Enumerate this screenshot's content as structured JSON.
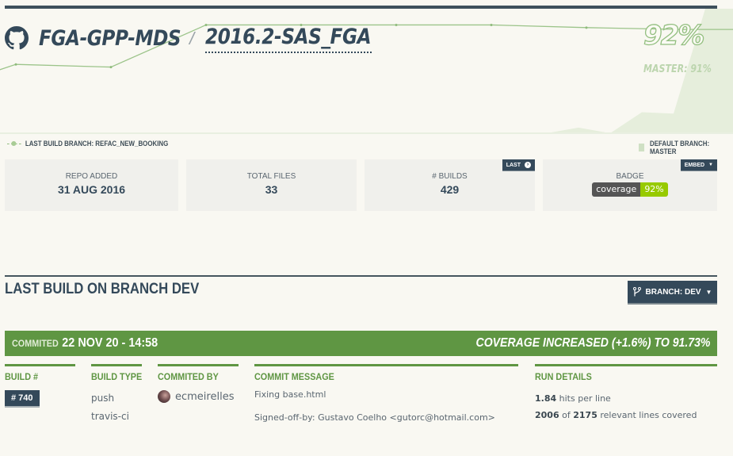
{
  "header": {
    "owner": "FGA-GPP-MDS",
    "separator": "/",
    "repo": "2016.2-SAS_FGA",
    "coverage_pct": "92%",
    "master_pct": "MASTER: 91%"
  },
  "chart_data": {
    "type": "line",
    "title": "",
    "series": [
      {
        "name": "Last build branch: refac_new_booking",
        "style": "line",
        "values": [
          84,
          87.5,
          87.2,
          91.9,
          91.9,
          91.9,
          91.9,
          91.6,
          91.4
        ]
      },
      {
        "name": "Default branch: master",
        "style": "area",
        "values": [
          0,
          0,
          0,
          0,
          0,
          0,
          0,
          4,
          0,
          15,
          14,
          91,
          91
        ]
      }
    ],
    "ylim": [
      80,
      93
    ],
    "legend": {
      "left": "LAST BUILD BRANCH: REFAC_NEW_BOOKING",
      "right": "DEFAULT BRANCH: MASTER"
    },
    "grid": false
  },
  "stats": [
    {
      "label": "REPO ADDED",
      "value": "31 AUG 2016"
    },
    {
      "label": "TOTAL FILES",
      "value": "33"
    },
    {
      "label": "# BUILDS",
      "value": "429",
      "tab": "LAST"
    },
    {
      "label": "BADGE",
      "tab": "EMBED",
      "badge_left": "coverage",
      "badge_right": "92%"
    }
  ],
  "colors": {
    "brand_dark": "#34495a",
    "success_green": "#5f9643",
    "badge_green": "#97ca00",
    "chart_line": "#8fbb7c",
    "chart_area": "#e6eedc"
  },
  "last_build": {
    "title": "LAST BUILD ON BRANCH DEV",
    "branch_button": "BRANCH: DEV",
    "committed_label": "COMMITED",
    "committed_value": "22 NOV 20 - 14:58",
    "coverage_change": "COVERAGE INCREASED (+1.6%) TO 91.73%",
    "columns": {
      "build_num_head": "BUILD #",
      "build_num": "# 740",
      "build_type_head": "BUILD TYPE",
      "build_type": "push",
      "build_service": "travis-ci",
      "committed_by_head": "COMMITED BY",
      "committer": "ecmeirelles",
      "message_head": "COMMIT MESSAGE",
      "message_line1": "Fixing base.html",
      "message_line2": "Signed-off-by: Gustavo Coelho <gutorc@hotmail.com>",
      "run_head": "RUN DETAILS",
      "hits_value": "1.84",
      "hits_label": " hits per line",
      "lines_covered": "2006",
      "lines_of": " of ",
      "lines_total": "2175",
      "lines_label": " relevant lines covered"
    }
  }
}
